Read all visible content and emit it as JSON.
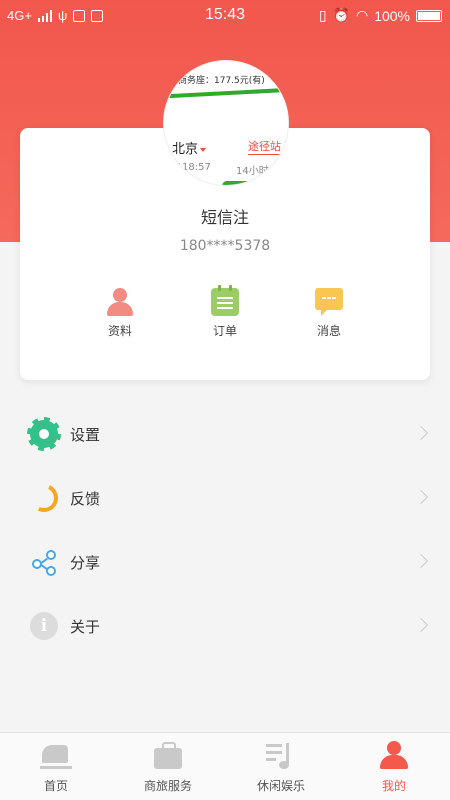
{
  "status_bar": {
    "network": "4G+",
    "time": "15:43",
    "battery": "100%"
  },
  "profile": {
    "avatar_texts": {
      "price": "商务座：177.5元(有)",
      "city": "北京",
      "via": "途径站",
      "departure": "18:57",
      "duration": "14小时1"
    },
    "username": "短信注",
    "phone": "180****5378"
  },
  "quick_actions": [
    {
      "label": "资料",
      "icon": "profile-icon"
    },
    {
      "label": "订单",
      "icon": "order-icon"
    },
    {
      "label": "消息",
      "icon": "message-icon"
    }
  ],
  "menu": [
    {
      "label": "设置",
      "icon": "gear-icon"
    },
    {
      "label": "反馈",
      "icon": "feedback-icon"
    },
    {
      "label": "分享",
      "icon": "share-icon"
    },
    {
      "label": "关于",
      "icon": "info-icon"
    }
  ],
  "tabs": [
    {
      "label": "首页",
      "icon": "train-icon"
    },
    {
      "label": "商旅服务",
      "icon": "suitcase-icon"
    },
    {
      "label": "休闲娱乐",
      "icon": "music-icon"
    },
    {
      "label": "我的",
      "icon": "person-icon",
      "active": true
    }
  ],
  "colors": {
    "brand_red": "#f35a4b",
    "header_bg": "#f2574c",
    "settings_green": "#33c089",
    "feedback_orange": "#f5a623",
    "share_blue": "#4aa8e0"
  }
}
